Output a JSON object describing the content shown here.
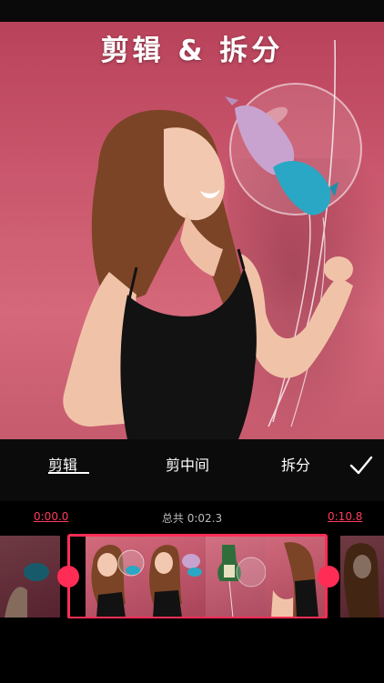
{
  "title": "剪辑 & 拆分",
  "tabs": [
    {
      "label": "剪辑",
      "selected": true
    },
    {
      "label": "剪中间",
      "selected": false
    },
    {
      "label": "拆分",
      "selected": false
    }
  ],
  "confirm_icon": "check-icon",
  "timeline": {
    "start_time": "0:00.0",
    "total": "总共 0:02.3",
    "end_time": "0:10.8"
  },
  "colors": {
    "accent": "#ff2d55",
    "time_label": "#ff3b5c"
  }
}
